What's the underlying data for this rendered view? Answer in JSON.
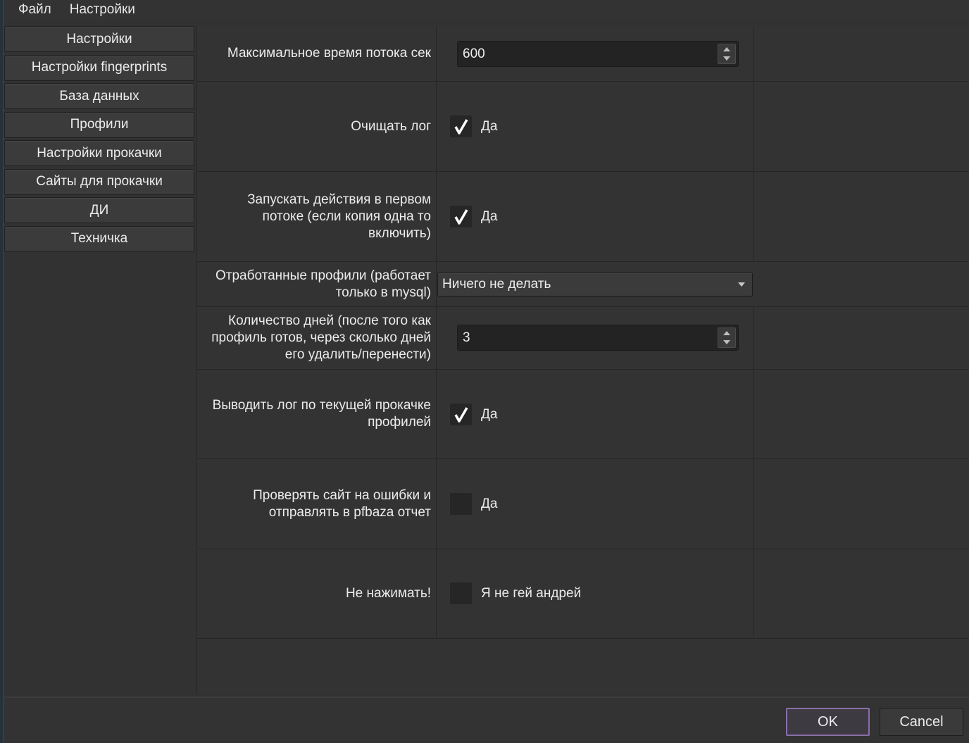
{
  "menubar": {
    "items": [
      "Файл",
      "Настройки"
    ]
  },
  "sidebar": {
    "items": [
      "Настройки",
      "Настройки fingerprints",
      "База данных",
      "Профили",
      "Настройки прокачки",
      "Сайты для прокачки",
      "ДИ",
      "Техничка"
    ]
  },
  "settings": {
    "max_thread_time": {
      "label": "Максимальное время потока сек",
      "value": "600"
    },
    "clear_log": {
      "label": "Очищать лог",
      "checked": true,
      "text": "Да"
    },
    "run_first_thread": {
      "label": "Запускать действия в первом потоке (если копия одна то включить)",
      "checked": true,
      "text": "Да"
    },
    "processed_profiles": {
      "label": "Отработанные профили (работает только в mysql)",
      "value": "Ничего не делать"
    },
    "days_count": {
      "label": "Количество дней (после того как профиль готов, через сколько дней его удалить/перенести)",
      "value": "3"
    },
    "output_log": {
      "label": "Выводить лог по текущей прокачке профилей",
      "checked": true,
      "text": "Да"
    },
    "check_site": {
      "label": "Проверять сайт на ошибки и отправлять в pfbaza отчет",
      "checked": false,
      "text": "Да"
    },
    "dont_press": {
      "label": "Не нажимать!",
      "checked": false,
      "text": "Я не гей андрей"
    }
  },
  "buttons": {
    "ok": "OK",
    "cancel": "Cancel"
  },
  "colors": {
    "accent": "#8a6fa8",
    "background": "#323232",
    "field": "#232323"
  }
}
